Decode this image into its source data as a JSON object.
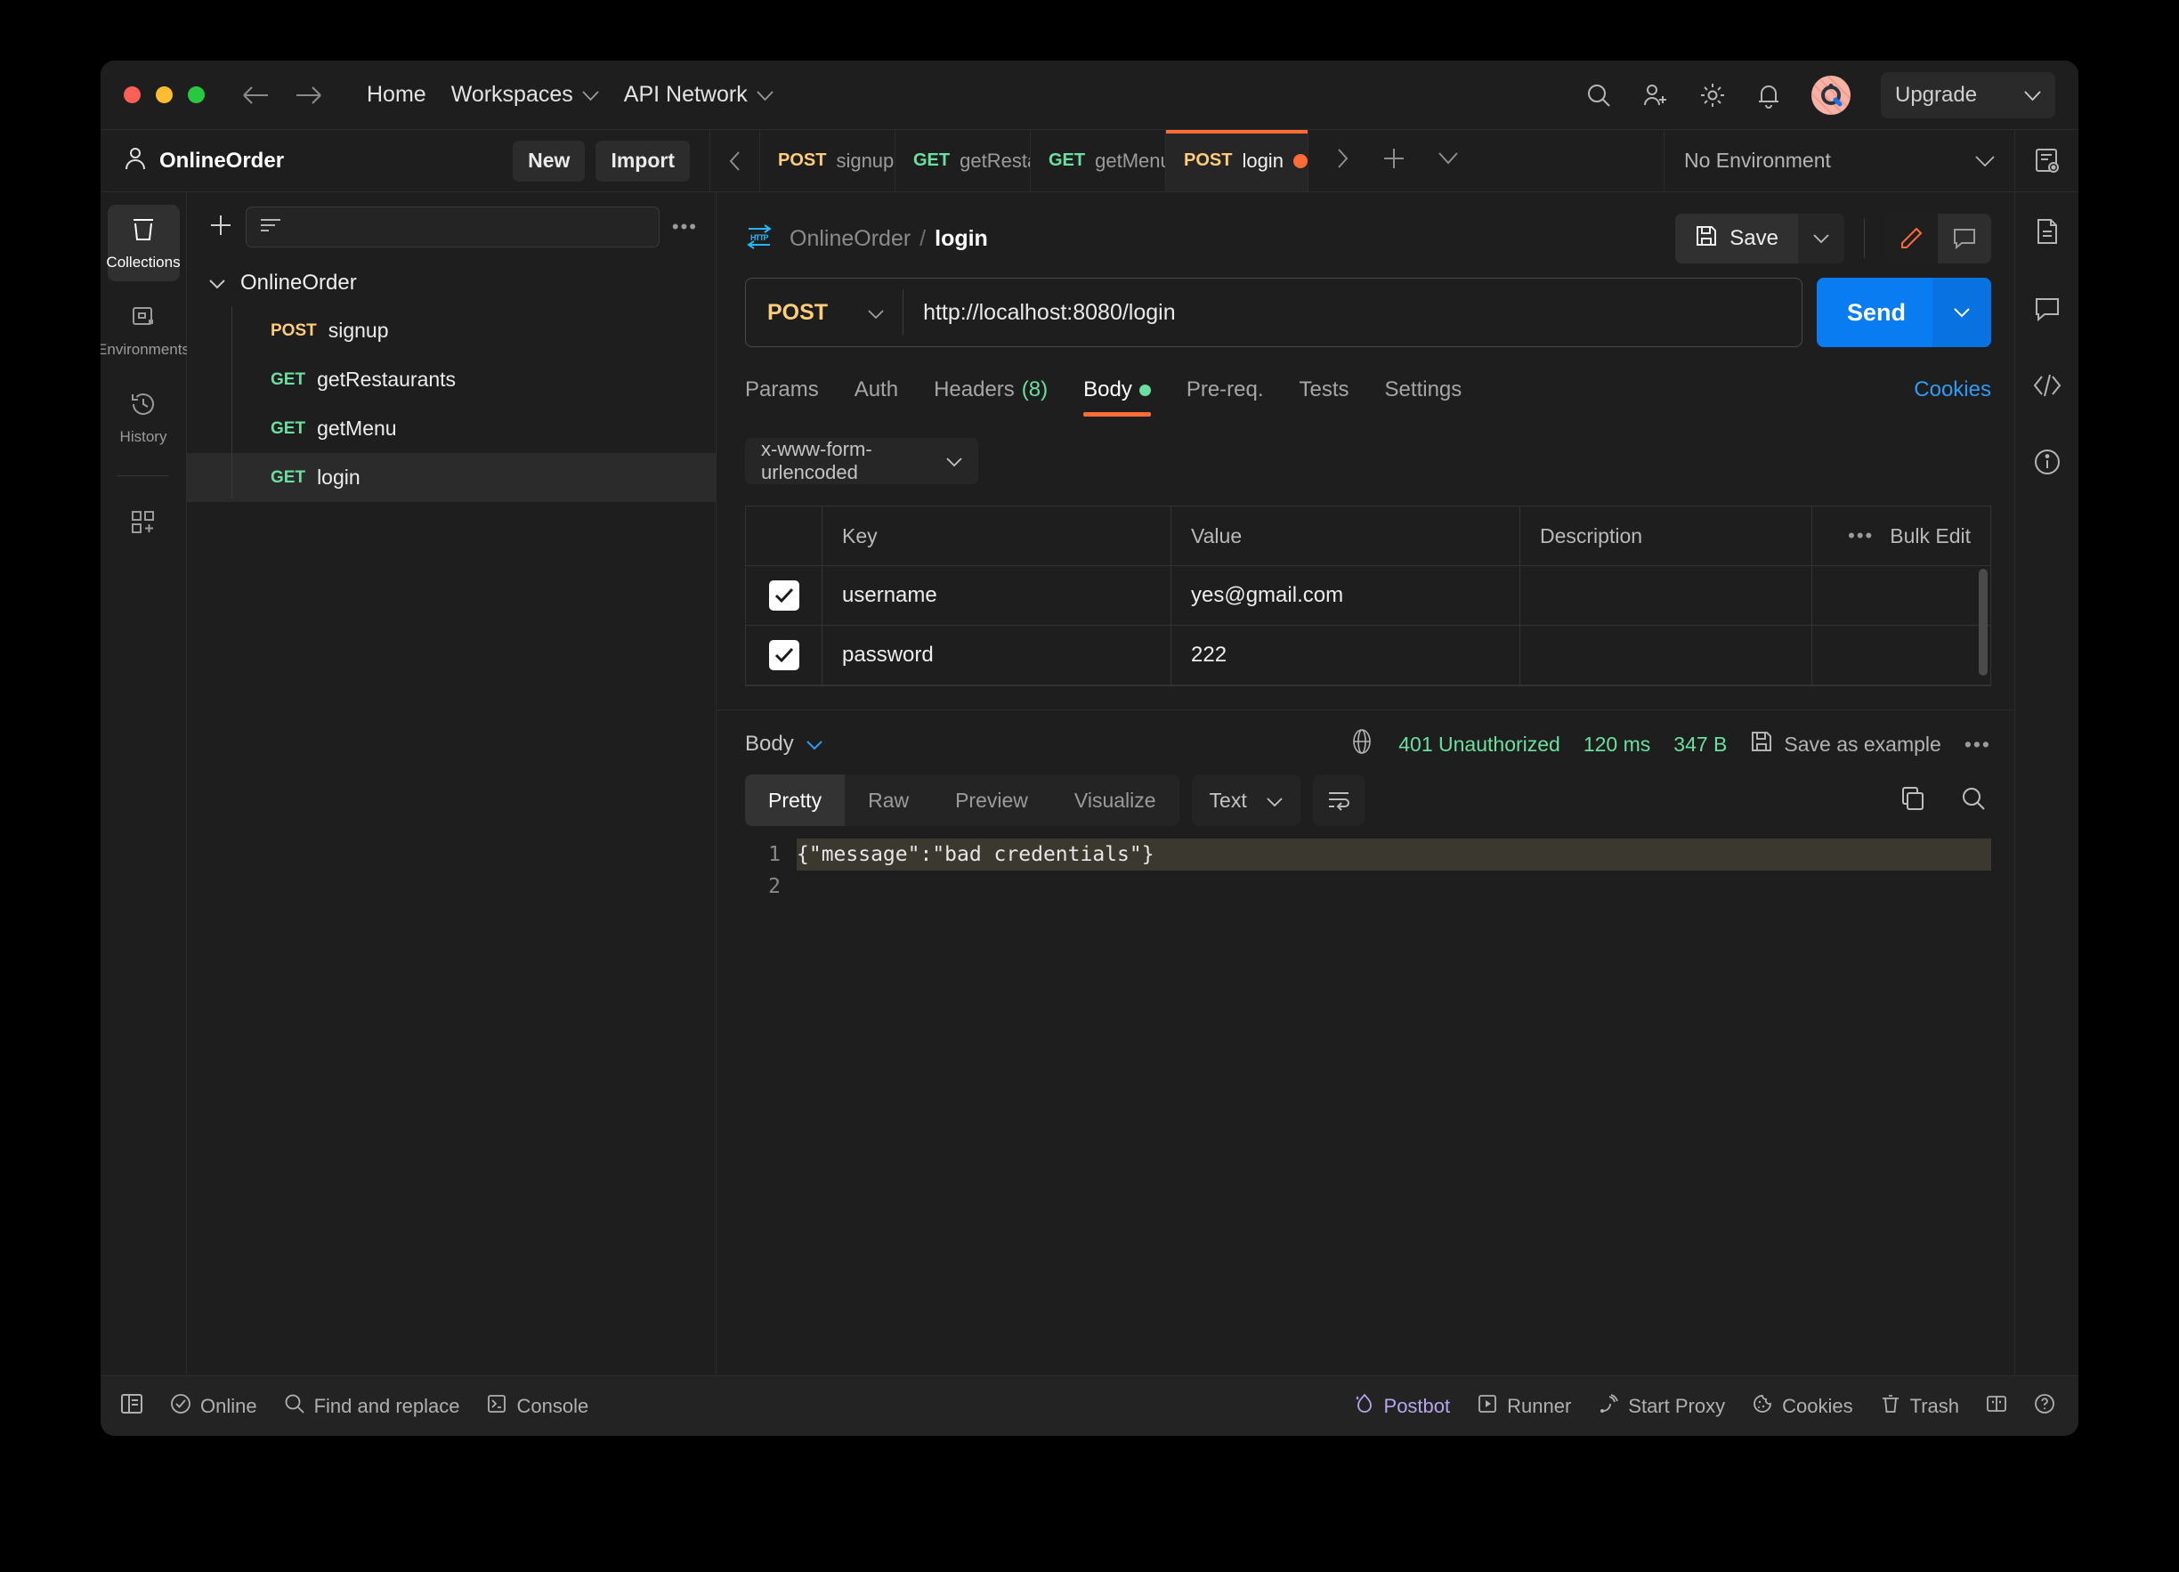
{
  "titlebar": {
    "nav": {
      "back": "back-arrow",
      "forward": "forward-arrow"
    },
    "home": "Home",
    "workspaces": "Workspaces",
    "api_network": "API Network",
    "upgrade": "Upgrade",
    "icons": [
      "search-icon",
      "invite-icon",
      "gear-icon",
      "bell-icon",
      "avatar"
    ]
  },
  "workspace": {
    "name": "OnlineOrder",
    "new_button": "New",
    "import_button": "Import"
  },
  "tabs": [
    {
      "method": "POST",
      "name": "signup",
      "unsaved": false,
      "active": false
    },
    {
      "method": "GET",
      "name": "getRestaurants",
      "unsaved": false,
      "active": false
    },
    {
      "method": "GET",
      "name": "getMenu",
      "unsaved": true,
      "active": false
    },
    {
      "method": "POST",
      "name": "login",
      "unsaved": true,
      "active": true
    }
  ],
  "environment": {
    "selected": "No Environment"
  },
  "rail": [
    {
      "label": "Collections",
      "icon": "collections-icon",
      "active": true
    },
    {
      "label": "Environments",
      "icon": "environments-icon",
      "active": false
    },
    {
      "label": "History",
      "icon": "history-icon",
      "active": false
    },
    {
      "label": "",
      "icon": "add-module-icon",
      "active": false
    }
  ],
  "sidebar": {
    "search_placeholder": "",
    "collection": "OnlineOrder",
    "requests": [
      {
        "method": "POST",
        "name": "signup",
        "selected": false
      },
      {
        "method": "GET",
        "name": "getRestaurants",
        "selected": false
      },
      {
        "method": "GET",
        "name": "getMenu",
        "selected": false
      },
      {
        "method": "GET",
        "name": "login",
        "selected": true
      }
    ]
  },
  "request": {
    "protocol_icon": "http-icon",
    "breadcrumb_collection": "OnlineOrder",
    "breadcrumb_current": "login",
    "save_label": "Save",
    "method": "POST",
    "url": "http://localhost:8080/login",
    "send_label": "Send",
    "tabs": [
      {
        "label": "Params",
        "badge": "",
        "active": false,
        "dot": false
      },
      {
        "label": "Auth",
        "badge": "",
        "active": false,
        "dot": false
      },
      {
        "label": "Headers",
        "badge": "(8)",
        "active": false,
        "dot": false
      },
      {
        "label": "Body",
        "badge": "",
        "active": true,
        "dot": true
      },
      {
        "label": "Pre-req.",
        "badge": "",
        "active": false,
        "dot": false
      },
      {
        "label": "Tests",
        "badge": "",
        "active": false,
        "dot": false
      },
      {
        "label": "Settings",
        "badge": "",
        "active": false,
        "dot": false
      }
    ],
    "cookies_link": "Cookies",
    "body_type": "x-www-form-urlencoded",
    "table": {
      "headers": [
        "Key",
        "Value",
        "Description"
      ],
      "bulk_edit": "Bulk Edit",
      "rows": [
        {
          "checked": true,
          "key": "username",
          "value": "yes@gmail.com",
          "description": ""
        },
        {
          "checked": true,
          "key": "password",
          "value": "222",
          "description": ""
        }
      ]
    }
  },
  "response": {
    "section_label": "Body",
    "status": "401 Unauthorized",
    "time": "120 ms",
    "size": "347 B",
    "save_as_example": "Save as example",
    "view_tabs": [
      {
        "label": "Pretty",
        "active": true
      },
      {
        "label": "Raw",
        "active": false
      },
      {
        "label": "Preview",
        "active": false
      },
      {
        "label": "Visualize",
        "active": false
      }
    ],
    "format": "Text",
    "lines": [
      "{\"message\":\"bad credentials\"}",
      ""
    ],
    "line_numbers": [
      "1",
      "2"
    ]
  },
  "statusbar": {
    "left": [
      {
        "label": "Online",
        "icon": "check-circle-icon"
      },
      {
        "label": "Find and replace",
        "icon": "search-icon"
      },
      {
        "label": "Console",
        "icon": "console-icon"
      }
    ],
    "right": [
      {
        "label": "Postbot",
        "icon": "postbot-icon"
      },
      {
        "label": "Runner",
        "icon": "runner-icon"
      },
      {
        "label": "Start Proxy",
        "icon": "proxy-icon"
      },
      {
        "label": "Cookies",
        "icon": "cookie-icon"
      },
      {
        "label": "Trash",
        "icon": "trash-icon"
      },
      {
        "label": "",
        "icon": "layout-icon"
      },
      {
        "label": "",
        "icon": "help-icon"
      }
    ]
  },
  "colors": {
    "accent_orange": "#ff6c37",
    "send_blue": "#0a7cf2",
    "get_green": "#6bdfa0",
    "post_yellow": "#ffcc7a",
    "link_blue": "#2f9bf5"
  }
}
